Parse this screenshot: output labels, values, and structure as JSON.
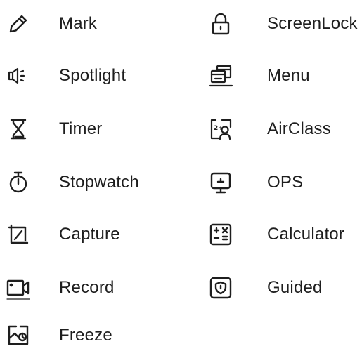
{
  "tools": {
    "left": [
      {
        "label": "Mark",
        "icon": "pencil-icon"
      },
      {
        "label": "Spotlight",
        "icon": "spotlight-icon"
      },
      {
        "label": "Timer",
        "icon": "hourglass-icon"
      },
      {
        "label": "Stopwatch",
        "icon": "stopwatch-icon"
      },
      {
        "label": "Capture",
        "icon": "capture-icon"
      },
      {
        "label": "Record",
        "icon": "video-camera-icon"
      },
      {
        "label": "Freeze",
        "icon": "freeze-image-icon"
      }
    ],
    "right": [
      {
        "label": "ScreenLock",
        "icon": "lock-icon"
      },
      {
        "label": "Menu",
        "icon": "menu-windows-icon"
      },
      {
        "label": "AirClass",
        "icon": "airclass-icon"
      },
      {
        "label": "OPS",
        "icon": "monitor-icon"
      },
      {
        "label": "Calculator",
        "icon": "calculator-icon"
      },
      {
        "label": "Guided",
        "icon": "shield-icon"
      }
    ]
  },
  "colors": {
    "text": "#1e1e1e",
    "icon_stroke": "#1e1e1e",
    "background": "#ffffff"
  }
}
